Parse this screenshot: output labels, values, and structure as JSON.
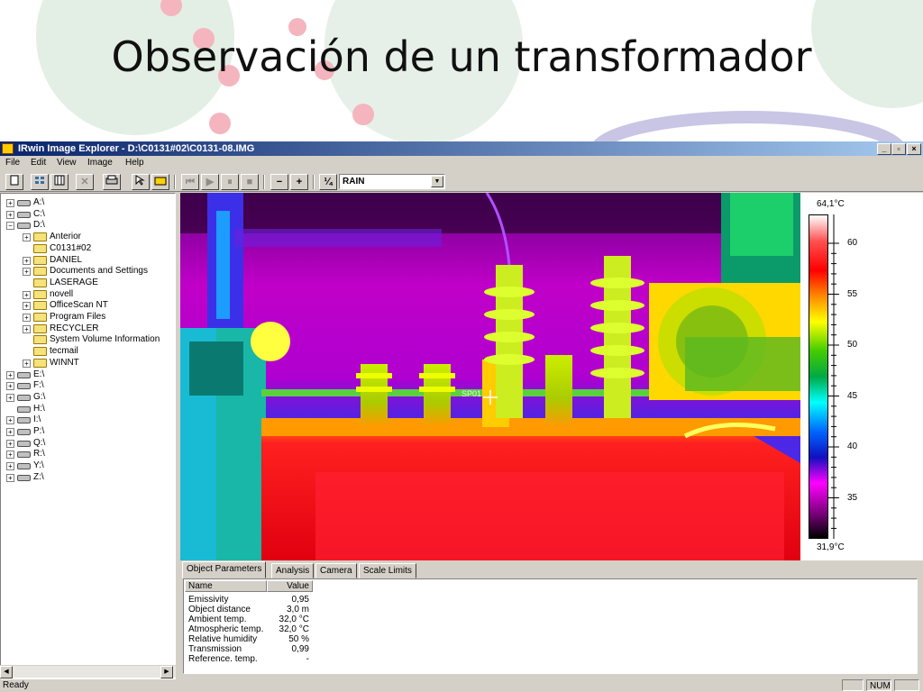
{
  "slide": {
    "title": "Observación de un transformador"
  },
  "window": {
    "title": "IRwin Image Explorer - D:\\C0131#02\\C0131-08.IMG",
    "controls": {
      "minimize": "_",
      "restore": "▫",
      "close": "×"
    }
  },
  "menu": [
    "File",
    "Edit",
    "View",
    "Image",
    "Help"
  ],
  "toolbar": {
    "palette_value": "RAIN",
    "fraction_label": "¼",
    "minus_label": "−",
    "plus_label": "+"
  },
  "tree": {
    "items": [
      {
        "label": "A:\\",
        "type": "drive",
        "expander": "+"
      },
      {
        "label": "C:\\",
        "type": "drive",
        "expander": "+"
      },
      {
        "label": "D:\\",
        "type": "drive",
        "expander": "−"
      },
      {
        "label": "Anterior",
        "type": "folder",
        "expander": "+"
      },
      {
        "label": "C0131#02",
        "type": "folder-open",
        "expander": ""
      },
      {
        "label": "DANIEL",
        "type": "folder",
        "expander": "+"
      },
      {
        "label": "Documents and Settings",
        "type": "folder",
        "expander": "+"
      },
      {
        "label": "LASERAGE",
        "type": "folder",
        "expander": ""
      },
      {
        "label": "novell",
        "type": "folder",
        "expander": "+"
      },
      {
        "label": "OfficeScan NT",
        "type": "folder",
        "expander": "+"
      },
      {
        "label": "Program Files",
        "type": "folder",
        "expander": "+"
      },
      {
        "label": "RECYCLER",
        "type": "folder",
        "expander": "+"
      },
      {
        "label": "System Volume Information",
        "type": "folder",
        "expander": ""
      },
      {
        "label": "tecmail",
        "type": "folder",
        "expander": ""
      },
      {
        "label": "WINNT",
        "type": "folder",
        "expander": "+"
      },
      {
        "label": "E:\\",
        "type": "drive",
        "expander": "+"
      },
      {
        "label": "F:\\",
        "type": "drive",
        "expander": "+"
      },
      {
        "label": "G:\\",
        "type": "drive",
        "expander": "+"
      },
      {
        "label": "H:\\",
        "type": "drive",
        "expander": ""
      },
      {
        "label": "I:\\",
        "type": "drive",
        "expander": "+"
      },
      {
        "label": "P:\\",
        "type": "drive",
        "expander": "+"
      },
      {
        "label": "Q:\\",
        "type": "drive",
        "expander": "+"
      },
      {
        "label": "R:\\",
        "type": "drive",
        "expander": "+"
      },
      {
        "label": "Y:\\",
        "type": "drive",
        "expander": "+"
      },
      {
        "label": "Z:\\",
        "type": "drive",
        "expander": "+"
      }
    ]
  },
  "thermal": {
    "spot_label": "SP01",
    "scale_max": "64,1°C",
    "scale_min": "31,9°C",
    "ticks": [
      "60",
      "55",
      "50",
      "45",
      "40",
      "35"
    ],
    "palette_colors": [
      "#ffffff",
      "#ff5050",
      "#ff0000",
      "#ff8800",
      "#ffff00",
      "#44cc00",
      "#00aa44",
      "#00ffff",
      "#0066ff",
      "#1010c0",
      "#ff00ff",
      "#800080",
      "#000000"
    ]
  },
  "tabs": [
    "Object Parameters",
    "Analysis",
    "Camera",
    "Scale Limits"
  ],
  "parameters": {
    "headers": {
      "name": "Name",
      "value": "Value"
    },
    "rows": [
      {
        "name": "Emissivity",
        "value": "0,95"
      },
      {
        "name": "Object distance",
        "value": "3,0 m"
      },
      {
        "name": "Ambient temp.",
        "value": "32,0 °C"
      },
      {
        "name": "Atmospheric temp.",
        "value": "32,0 °C"
      },
      {
        "name": "Relative humidity",
        "value": "50 %"
      },
      {
        "name": "Transmission",
        "value": "0,99"
      },
      {
        "name": "Reference. temp.",
        "value": "-"
      }
    ]
  },
  "status": {
    "left": "Ready",
    "num": "NUM"
  }
}
